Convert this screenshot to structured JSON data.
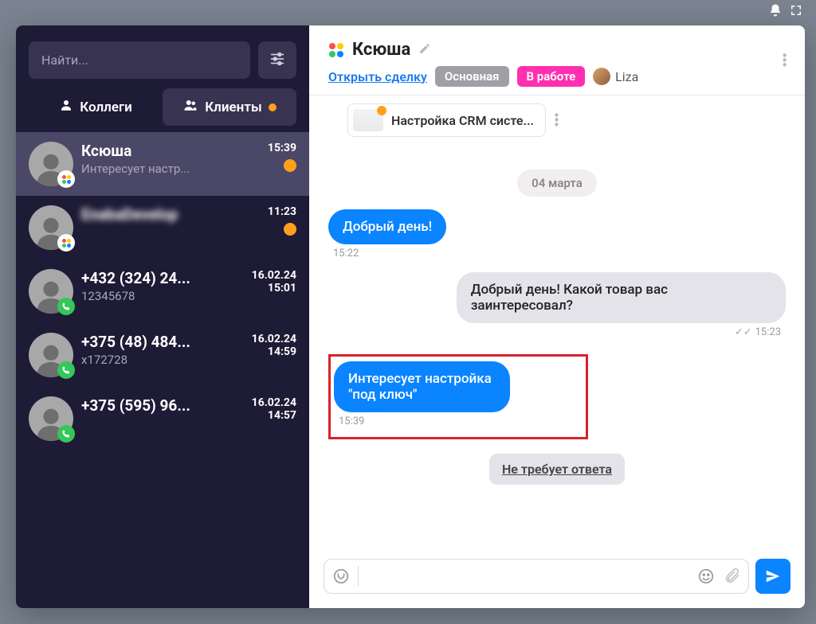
{
  "search": {
    "placeholder": "Найти..."
  },
  "tabs": {
    "colleagues": "Коллеги",
    "clients": "Клиенты"
  },
  "conversations": [
    {
      "title": "Ксюша",
      "subtitle": "Интересует настр...",
      "time": "15:39",
      "unread": true,
      "badge": "multi",
      "selected": true
    },
    {
      "title": "EnabaDevelop",
      "subtitle": " ",
      "time": "11:23",
      "unread": true,
      "badge": "multi",
      "blurTitle": true,
      "blurSub": true
    },
    {
      "title": "+432 (324) 24...",
      "subtitle": "12345678",
      "date": "16.02.24",
      "time": "15:01",
      "badge": "phone"
    },
    {
      "title": "+375 (48) 484...",
      "subtitle": "x172728",
      "date": "16.02.24",
      "time": "14:59",
      "badge": "phone"
    },
    {
      "title": "+375 (595) 96...",
      "subtitle": " ",
      "date": "16.02.24",
      "time": "14:57",
      "badge": "phone",
      "blurSub": true
    }
  ],
  "chat": {
    "name": "Ксюша",
    "open_deal": "Открыть сделку",
    "pill_main": "Основная",
    "pill_status": "В работе",
    "assignee": "Liza",
    "card_title": "Настройка CRM систе...",
    "date_sep": "04 марта",
    "messages": [
      {
        "side": "left",
        "style": "blue",
        "text": "Добрый день!",
        "time": "15:22"
      },
      {
        "side": "right",
        "style": "gray",
        "text": "Добрый день! Какой товар вас заинтересовал?",
        "time": "15:23",
        "checks": true
      },
      {
        "side": "left",
        "style": "blue",
        "text": "Интересует настройка \"под ключ\"",
        "time": "15:39",
        "highlight": true
      }
    ],
    "noreply": "Не требует ответа"
  },
  "composer": {
    "placeholder": ""
  }
}
